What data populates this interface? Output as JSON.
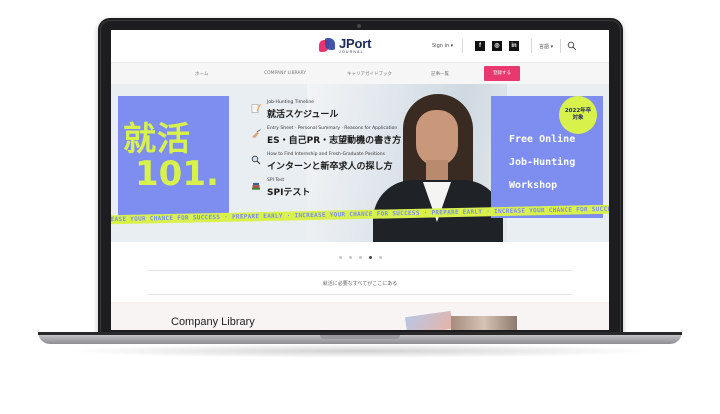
{
  "header": {
    "logo_main": "JPort",
    "logo_sub": "JOURNAL",
    "signin": "Sign in ▾",
    "social": [
      "f",
      "◎",
      "in"
    ],
    "lang": "言語 ▾"
  },
  "nav": {
    "items": [
      "ホーム",
      "COMPANY LIBRARY",
      "キャリアガイドブック",
      "記事一覧"
    ],
    "cta": "登録する"
  },
  "hero": {
    "big_line1": "就活",
    "big_line2": "101.",
    "topics": [
      {
        "sub": "Job-Hunting Timeline",
        "main": "就活スケジュール",
        "icon": "notepad-pencil-icon"
      },
      {
        "sub": "Entry Sheet · Personal Summary · Reasons for Application",
        "main": "ES・自己PR・志望動機の書き方",
        "icon": "writing-hand-icon"
      },
      {
        "sub": "How to Find Internship and Fresh-Graduate Positions",
        "main": "インターンと新卒求人の探し方",
        "icon": "magnifier-icon"
      },
      {
        "sub": "SPI Test",
        "main": "SPIテスト",
        "icon": "books-icon"
      }
    ],
    "badge_line1": "2022年卒",
    "badge_line2": "対象",
    "workshop": [
      "Free Online",
      "Job-Hunting",
      "Workshop"
    ],
    "ribbon": "INCREASE YOUR CHANCE FOR SUCCESS · PREPARE EARLY · INCREASE YOUR CHANCE FOR SUCCESS · PREPARE EARLY · INCREASE YOUR CHANCE FOR SUCCESS · PREPARE EARLY · INCREASE YOUR CHA"
  },
  "carousel": {
    "count": 5,
    "active_index": 3
  },
  "tagline": "就活に必要なすべてがここにある",
  "library": {
    "title": "Company Library"
  },
  "colors": {
    "accent_pink": "#e8386f",
    "hero_blue": "#7d8df0",
    "lime": "#d9f24b",
    "navy": "#1e2a55"
  }
}
